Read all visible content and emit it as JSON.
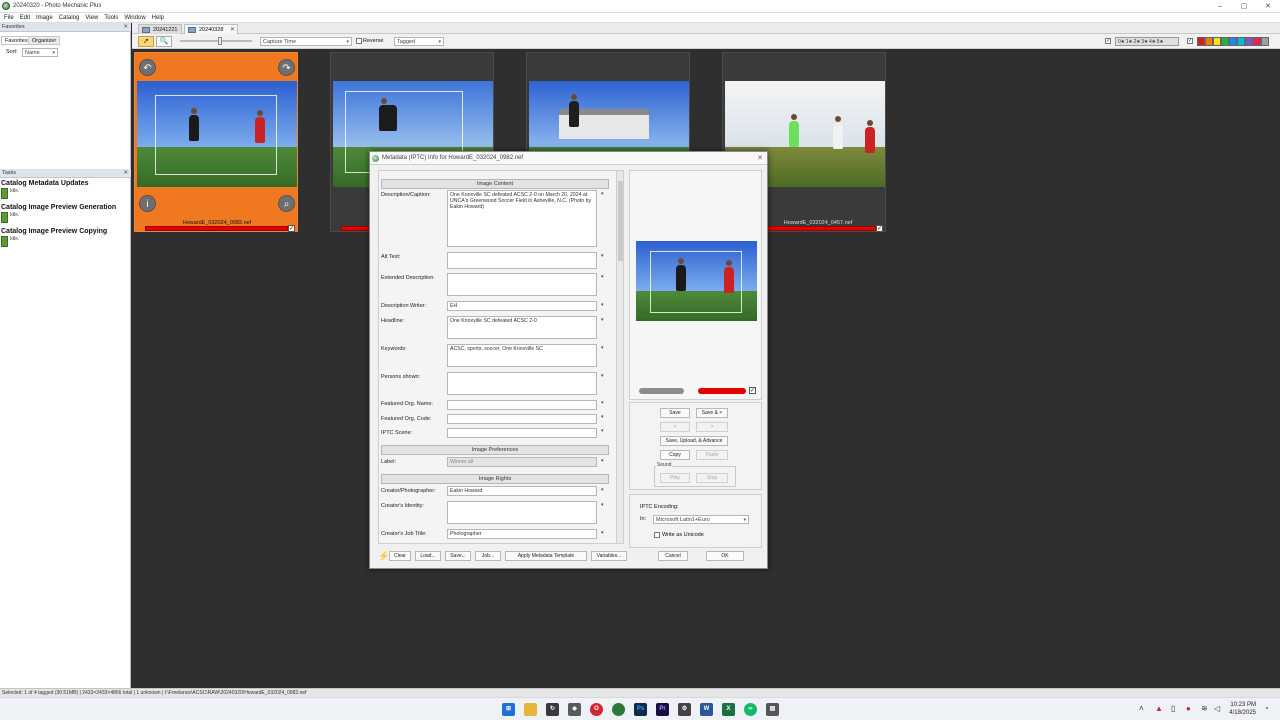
{
  "window": {
    "title": "20240320 - Photo Mechanic Plus"
  },
  "menu": [
    "File",
    "Edit",
    "Image",
    "Catalog",
    "View",
    "Tools",
    "Window",
    "Help"
  ],
  "tabs": [
    {
      "label": "20241221"
    },
    {
      "label": "20240328"
    }
  ],
  "toolbar": {
    "sort_field": "Capture Time",
    "reverse_label": "Reverse",
    "filter_field": "Tagged",
    "stars": "0★ 1★ 2★ 3★ 4★ 5★"
  },
  "color_classes": [
    "#d81b1b",
    "#f57c00",
    "#f3e21b",
    "#22b14c",
    "#1e88e5",
    "#00bcd4",
    "#7e57c2",
    "#e91e63",
    "#9e9e9e"
  ],
  "left": {
    "favorites_header": "Favorites",
    "tabs": [
      "Favorites",
      "Organizer"
    ],
    "sort_label": "Sort:",
    "sort_value": "Name",
    "tasks_header": "Tasks",
    "tasks": [
      {
        "title": "Catalog Metadata Updates",
        "status": "Idle."
      },
      {
        "title": "Catalog Image Preview Generation",
        "status": "Idle."
      },
      {
        "title": "Catalog Image Preview Copying",
        "status": "Idle."
      }
    ]
  },
  "thumbnails": [
    {
      "filename": "HowardE_032024_0982.nef",
      "selected": true
    },
    {
      "filename": "",
      "selected": false
    },
    {
      "filename": "",
      "selected": false
    },
    {
      "filename": "HowardE_032024_0457.nef",
      "selected": false
    }
  ],
  "dialog": {
    "title": "Metadata (IPTC) Info for HowardE_032024_0982.nef",
    "sections": {
      "content": "Image Content",
      "preferences": "Image Preferences",
      "rights": "Image Rights"
    },
    "fields": {
      "description_label": "Description/Caption:",
      "description_value": "One Knoxville SC defeated ACSC 2-0 on March 20, 2024 at UNCA's Greenwood Soccer Field in Asheville, N.C. (Photo by Eakin Howard)",
      "alt_label": "Alt Text:",
      "ext_label": "Extended Description:",
      "writer_label": "Description Writer:",
      "writer_value": "EH",
      "headline_label": "Headline:",
      "headline_value": "One Knoxville SC defeated ACSC 2-0",
      "keywords_label": "Keywords:",
      "keywords_value": "ACSC, sports, soccer, One Knoxville SC",
      "persons_label": "Persons shown:",
      "org_name_label": "Featured Org. Name:",
      "org_code_label": "Featured Org. Code:",
      "scene_label": "IPTC Scene:",
      "label_label": "Label:",
      "label_value": "Winner all",
      "creator_label": "Creator/Photographer:",
      "creator_value": "Eakin Howard",
      "identity_label": "Creator's Identity:",
      "jobtitle_label": "Creator's Job Title:",
      "jobtitle_value": "Photographer"
    },
    "buttons": {
      "save": "Save",
      "save_next": "Save & >",
      "prev": "<",
      "next": ">",
      "save_upload": "Save, Upload, & Advance",
      "copy": "Copy",
      "paste": "Paste",
      "sound": "Sound",
      "play": "Play",
      "stop": "Stop",
      "cancel": "Cancel",
      "ok": "OK"
    },
    "encoding": {
      "header": "IPTC Encoding:",
      "in_label": "In:",
      "value": "Microsoft Latin1+Euro",
      "unicode_label": "Write as Unicode"
    },
    "bottom": {
      "clear": "Clear",
      "load": "Load...",
      "save": "Save...",
      "job": "Job...",
      "apply": "Apply Metadata Template",
      "variables": "Variables..."
    }
  },
  "statusbar": {
    "text": "Selected: 1 of 4 tagged (30.51MB) | 2433×2433×4866 total | 1 unknown | I:\\Freelance\\ACSC\\RAW\\20240320\\HowardE_032024_0982.nef"
  },
  "clock": {
    "time": "10:23 PM",
    "date": "4/18/2025"
  }
}
